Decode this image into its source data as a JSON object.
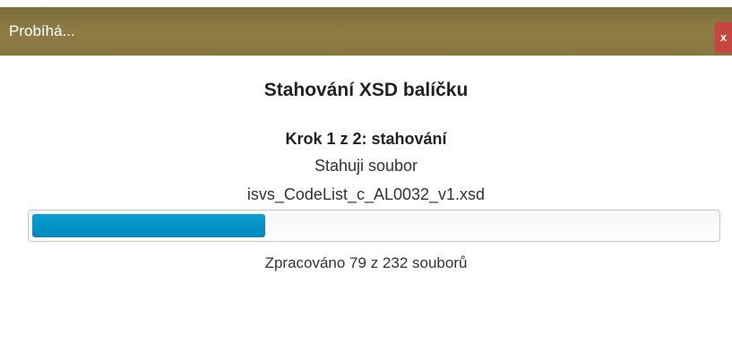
{
  "window": {
    "title": "Probíhá...",
    "close_label": "x"
  },
  "dialog": {
    "heading": "Stahování XSD balíčku",
    "step": "Krok 1 z 2: stahování",
    "status": "Stahuji soubor",
    "filename": "isvs_CodeList_c_AL0032_v1.xsd",
    "processed_text": "Zpracováno 79 z 232 souborů"
  },
  "progress": {
    "completed": 79,
    "total": 232
  },
  "colors": {
    "titlebar": "#8a7a40",
    "close_button": "#c4463e",
    "progress_fill": "#0096c9"
  }
}
